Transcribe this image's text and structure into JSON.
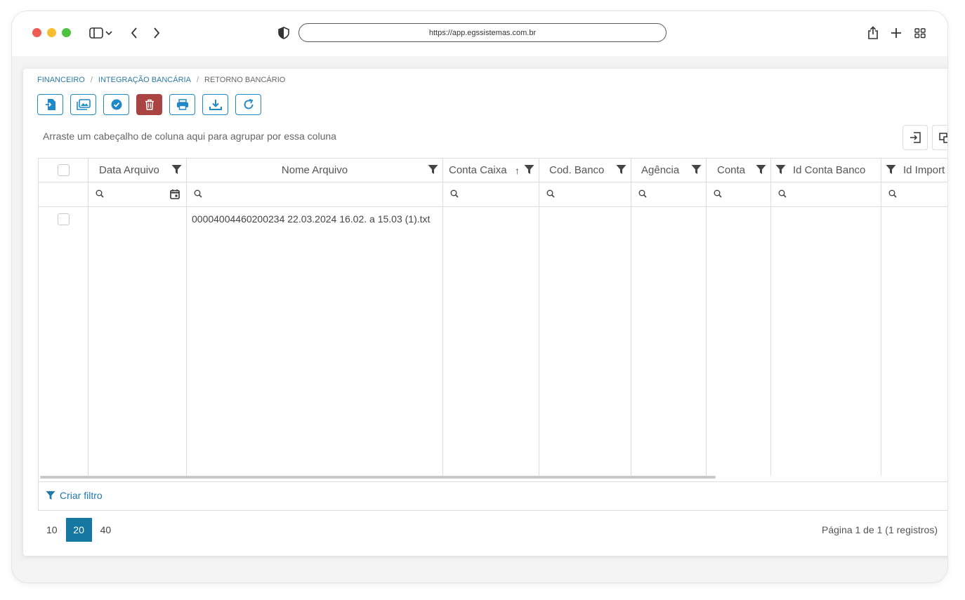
{
  "browser": {
    "url": "https://app.egssistemas.com.br"
  },
  "breadcrumb": {
    "items": [
      "FINANCEIRO",
      "INTEGRAÇÃO BANCÁRIA",
      "RETORNO BANCÁRIO"
    ],
    "separator": "/"
  },
  "grid": {
    "group_hint": "Arraste um cabeçalho de coluna aqui para agrupar por essa coluna",
    "columns": {
      "data_arquivo": "Data Arquivo",
      "nome_arquivo": "Nome Arquivo",
      "conta_caixa": "Conta Caixa",
      "cod_banco": "Cod. Banco",
      "agencia": "Agência",
      "conta": "Conta",
      "id_conta_banco": "Id Conta Banco",
      "id_import": "Id Import"
    },
    "sort_indicator": "↑",
    "rows": [
      {
        "nome_arquivo": "00004004460200234 22.03.2024 16.02. a 15.03 (1).txt"
      }
    ]
  },
  "filter_bar": {
    "create_filter": "Criar filtro"
  },
  "pager": {
    "sizes": [
      "10",
      "20",
      "40"
    ],
    "selected": "20",
    "info": "Página 1 de 1 (1 registros)"
  },
  "colors": {
    "accent": "#1e88c8",
    "danger": "#a94442",
    "pager_active": "#1677a2"
  }
}
